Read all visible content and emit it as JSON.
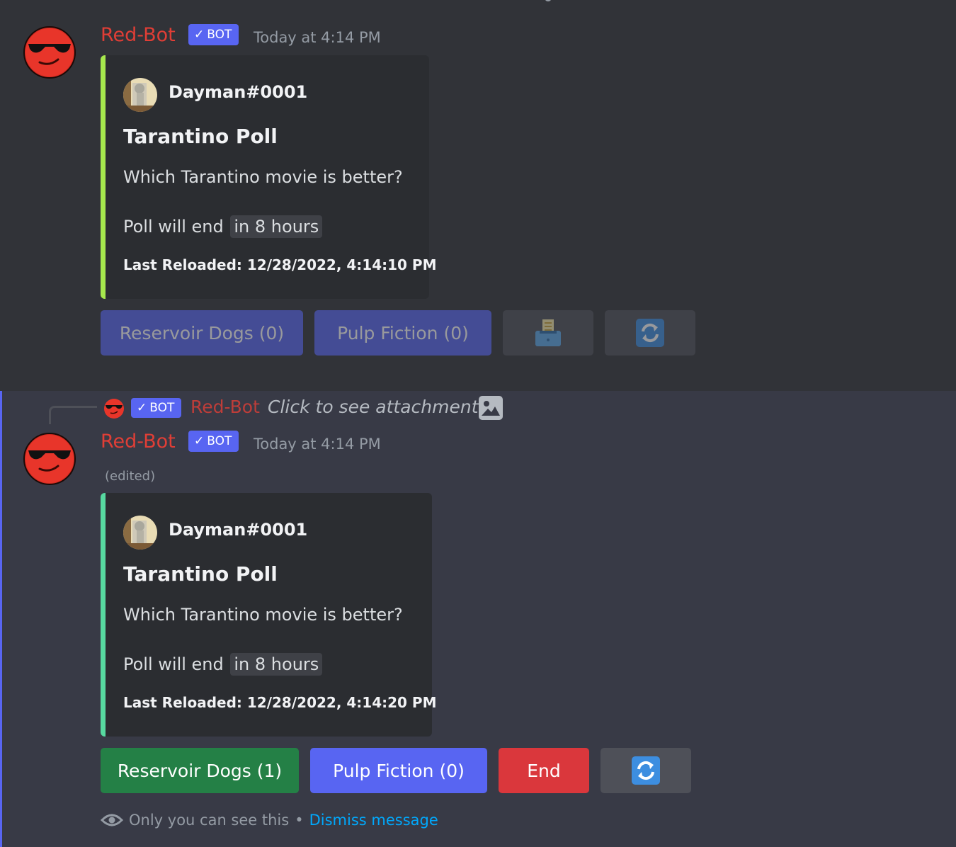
{
  "messages": [
    {
      "author": "Red-Bot",
      "bot_tag": "BOT",
      "timestamp": "Today at 4:14 PM",
      "embed": {
        "accent_color": "#a6e84d",
        "author": "Dayman#0001",
        "title": "Tarantino Poll",
        "description": "Which Tarantino movie is better?",
        "end_prefix": "Poll will end",
        "end_time": "in 8 hours",
        "footer": "Last Reloaded: 12/28/2022, 4:14:10 PM"
      },
      "buttons": [
        {
          "label": "Reservoir Dogs (0)",
          "style": "blurple",
          "disabled": true
        },
        {
          "label": "Pulp Fiction (0)",
          "style": "blurple",
          "disabled": true
        },
        {
          "icon": "ballot-box-icon",
          "style": "grey",
          "disabled": true
        },
        {
          "icon": "refresh-icon",
          "style": "grey",
          "disabled": true
        }
      ]
    },
    {
      "reply": {
        "author": "Red-Bot",
        "bot_tag": "BOT",
        "text": "Click to see attachment",
        "icon": "image-icon"
      },
      "author": "Red-Bot",
      "bot_tag": "BOT",
      "timestamp": "Today at 4:14 PM",
      "edited": "(edited)",
      "embed": {
        "accent_color": "#57d9a0",
        "author": "Dayman#0001",
        "title": "Tarantino Poll",
        "description": "Which Tarantino movie is better?",
        "end_prefix": "Poll will end",
        "end_time": "in 8 hours",
        "footer": "Last Reloaded: 12/28/2022, 4:14:20 PM"
      },
      "buttons": [
        {
          "label": "Reservoir Dogs (1)",
          "style": "green",
          "disabled": false
        },
        {
          "label": "Pulp Fiction (0)",
          "style": "blurple",
          "disabled": false
        },
        {
          "label": "End",
          "style": "red",
          "disabled": false
        },
        {
          "icon": "refresh-icon",
          "style": "grey",
          "disabled": false
        }
      ],
      "ephemeral": {
        "notice": "Only you can see this",
        "separator": "•",
        "dismiss": "Dismiss message"
      }
    }
  ],
  "colors": {
    "username": "#e03e36",
    "blurple": "#5865f2",
    "green": "#248046",
    "red": "#da373c",
    "grey": "#4e5058",
    "link": "#00a8fc"
  }
}
